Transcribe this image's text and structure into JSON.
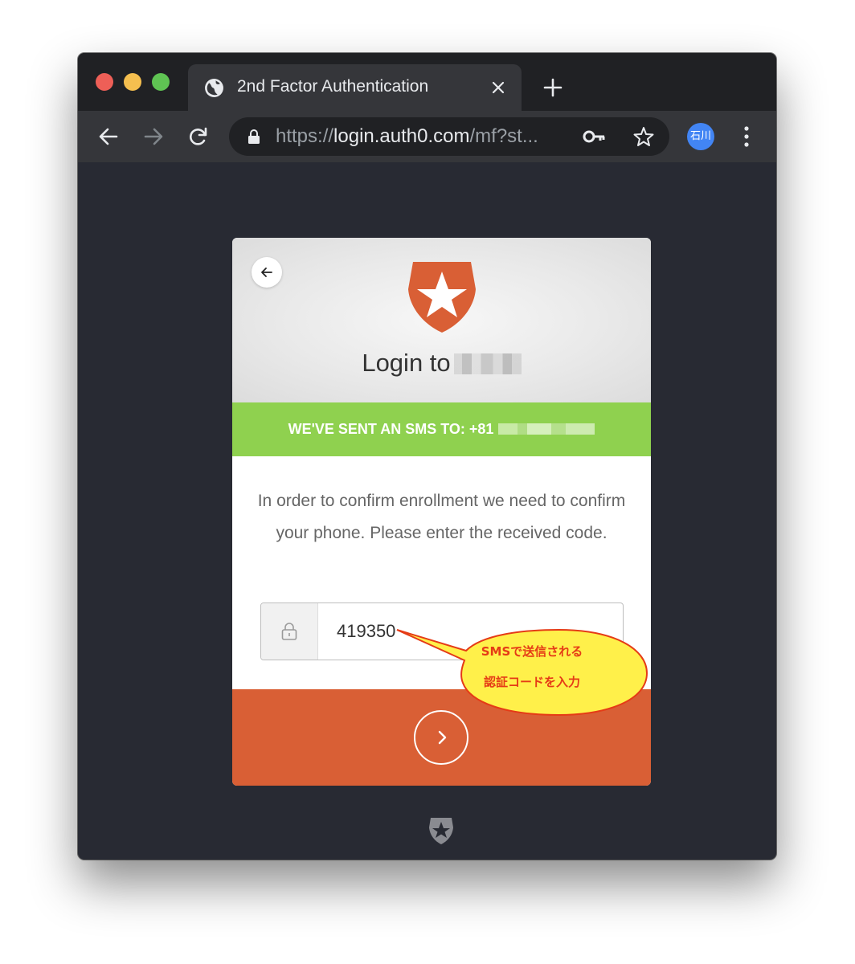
{
  "browser": {
    "tab_title": "2nd Factor Authentication",
    "url_secure": "https://",
    "url_domain": "login.auth0.com",
    "url_path": "/mf?st...",
    "profile_initials": "石川",
    "icons": [
      "globe-icon",
      "close-icon",
      "plus-icon",
      "back-arrow-icon",
      "forward-arrow-icon",
      "reload-icon",
      "lock-icon",
      "key-icon",
      "star-icon",
      "more-vert-icon"
    ]
  },
  "card": {
    "title": "Login to",
    "sms_banner": "WE'VE SENT AN SMS TO: +81",
    "instructions": "In order to confirm enrollment we need to confirm your phone. Please enter the received code.",
    "code_value": "419350"
  },
  "callout": {
    "line1": "SMSで送信される",
    "line2": "認証コードを入力"
  },
  "colors": {
    "brand": "#d95f35",
    "banner": "#8fd14f",
    "page_bg": "#282a33",
    "callout_fill": "#fff04a",
    "callout_text": "#e53b16"
  }
}
